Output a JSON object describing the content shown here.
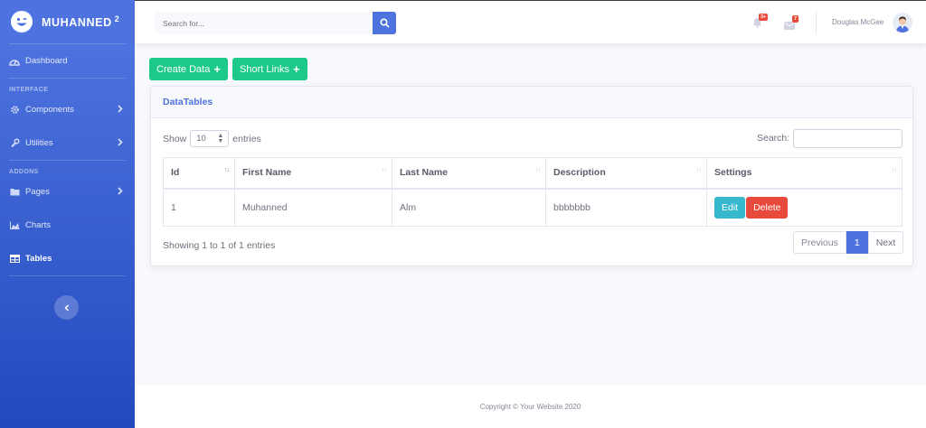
{
  "brand": {
    "name": "MUHANNED",
    "sup": "2"
  },
  "sidebar": {
    "dashboard": "Dashboard",
    "heading_interface": "INTERFACE",
    "components": "Components",
    "utilities": "Utilities",
    "heading_addons": "ADDONS",
    "pages": "Pages",
    "charts": "Charts",
    "tables": "Tables"
  },
  "topbar": {
    "search_placeholder": "Search for...",
    "alerts_badge": "3+",
    "messages_badge": "7",
    "user_name": "Douglas McGee"
  },
  "actions": {
    "create": "Create Data",
    "links": "Short Links"
  },
  "card": {
    "title": "DataTables",
    "show": "Show",
    "entries_value": "10",
    "entries": "entries",
    "search_label": "Search:",
    "columns": [
      "Id",
      "First Name",
      "Last Name",
      "Description",
      "Settings"
    ],
    "rows": [
      {
        "id": "1",
        "first": "Muhanned",
        "last": "Alm",
        "desc": "bbbbbbb",
        "edit": "Edit",
        "delete": "Delete"
      }
    ],
    "showing": "Showing 1 to 1 of 1 entries",
    "prev": "Previous",
    "page": "1",
    "next": "Next"
  },
  "footer": {
    "text": "Copyright © Your Website 2020"
  },
  "colors": {
    "primary": "#4e73df",
    "success": "#1cc88a",
    "info": "#36b9cc",
    "danger": "#e74a3b"
  }
}
